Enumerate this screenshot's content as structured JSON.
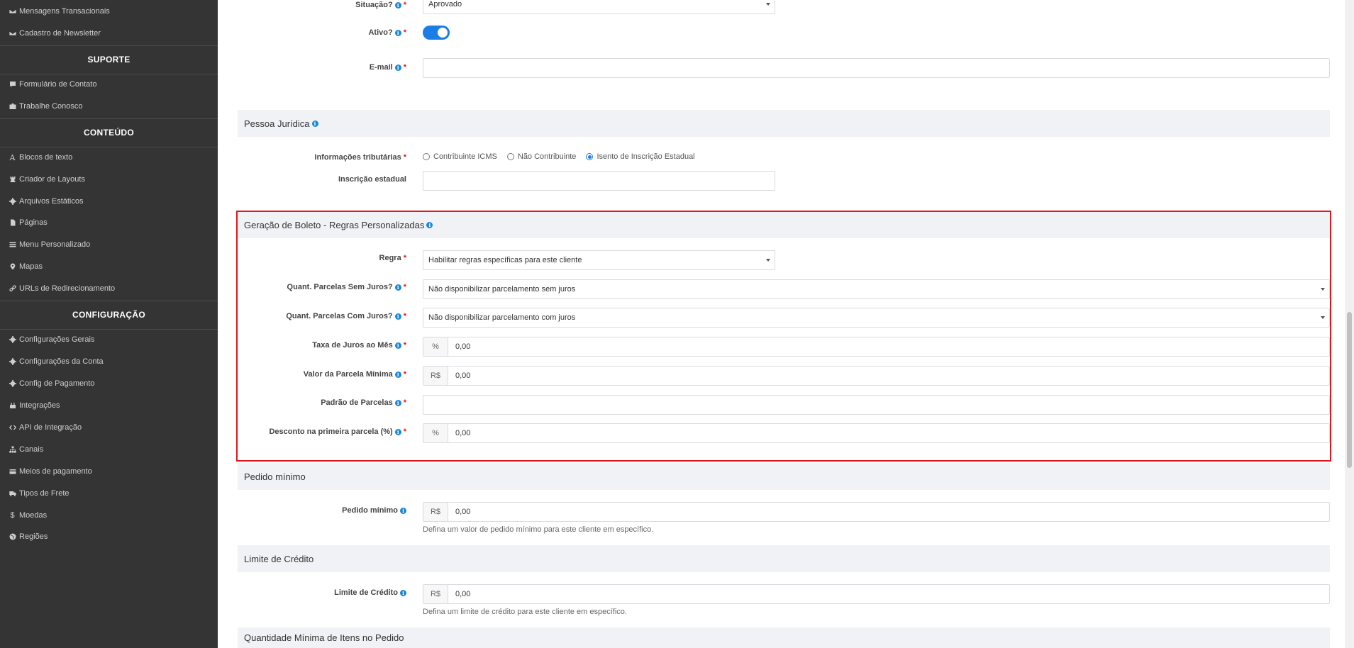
{
  "sidebar": {
    "items_top": [
      {
        "label": "Mensagens Transacionais",
        "icon": "envelope-icon"
      },
      {
        "label": "Cadastro de Newsletter",
        "icon": "envelope-icon"
      }
    ],
    "suporte_title": "SUPORTE",
    "suporte_items": [
      {
        "label": "Formulário de Contato",
        "icon": "comment-icon"
      },
      {
        "label": "Trabalhe Conosco",
        "icon": "briefcase-icon"
      }
    ],
    "conteudo_title": "CONTEÚDO",
    "conteudo_items": [
      {
        "label": "Blocos de texto",
        "icon": "font-icon"
      },
      {
        "label": "Criador de Layouts",
        "icon": "chess-rook-icon"
      },
      {
        "label": "Arquivos Estáticos",
        "icon": "gear-icon"
      },
      {
        "label": "Páginas",
        "icon": "file-icon"
      },
      {
        "label": "Menu Personalizado",
        "icon": "bars-icon"
      },
      {
        "label": "Mapas",
        "icon": "map-marker-icon"
      },
      {
        "label": "URLs de Redirecionamento",
        "icon": "link-icon"
      }
    ],
    "config_title": "CONFIGURAÇÃO",
    "config_items": [
      {
        "label": "Configurações Gerais",
        "icon": "gear-icon"
      },
      {
        "label": "Configurações da Conta",
        "icon": "gear-icon"
      },
      {
        "label": "Config de Pagamento",
        "icon": "gear-icon"
      },
      {
        "label": "Integrações",
        "icon": "plug-icon"
      },
      {
        "label": "API de Integração",
        "icon": "code-icon"
      },
      {
        "label": "Canais",
        "icon": "sitemap-icon"
      },
      {
        "label": "Meios de pagamento",
        "icon": "credit-card-icon"
      },
      {
        "label": "Tipos de Frete",
        "icon": "truck-icon"
      },
      {
        "label": "Moedas",
        "icon": "dollar-icon"
      },
      {
        "label": "Regiões",
        "icon": "globe-icon"
      }
    ]
  },
  "form": {
    "situacao": {
      "label": "Situação?",
      "value": "Aprovado"
    },
    "ativo": {
      "label": "Ativo?",
      "on": true
    },
    "email": {
      "label": "E-mail",
      "value": ""
    },
    "pj": {
      "title": "Pessoa Jurídica",
      "info_label": "Informações tributárias",
      "options": [
        "Contribuinte ICMS",
        "Não Contribuinte",
        "Isento de Inscrição Estadual"
      ],
      "selected": "Isento de Inscrição Estadual",
      "ie_label": "Inscrição estadual",
      "ie_value": ""
    },
    "boleto": {
      "title": "Geração de Boleto - Regras Personalizadas",
      "regra_label": "Regra",
      "regra_value": "Habilitar regras específicas para este cliente",
      "sem_juros_label": "Quant. Parcelas Sem Juros?",
      "sem_juros_value": "Não disponibilizar parcelamento sem juros",
      "com_juros_label": "Quant. Parcelas Com Juros?",
      "com_juros_value": "Não disponibilizar parcelamento com juros",
      "taxa_label": "Taxa de Juros ao Mês",
      "taxa_addon": "%",
      "taxa_value": "0,00",
      "parcela_min_label": "Valor da Parcela Mínima",
      "parcela_min_addon": "R$",
      "parcela_min_value": "0,00",
      "padrao_label": "Padrão de Parcelas",
      "padrao_value": "",
      "desconto_label": "Desconto na primeira parcela (%)",
      "desconto_addon": "%",
      "desconto_value": "0,00"
    },
    "pedido": {
      "title": "Pedido mínimo",
      "label": "Pedido mínimo",
      "addon": "R$",
      "value": "0,00",
      "help": "Defina um valor de pedido mínimo para este cliente em específico."
    },
    "credito": {
      "title": "Limite de Crédito",
      "label": "Limite de Crédito",
      "addon": "R$",
      "value": "0,00",
      "help": "Defina um limite de crédito para este cliente em específico."
    },
    "qtd_min_title": "Quantidade Mínima de Itens no Pedido"
  },
  "colors": {
    "accent": "#1a7ee6",
    "highlight": "#e3151a",
    "sidebar_bg": "#343434",
    "required": "#e0161b"
  }
}
